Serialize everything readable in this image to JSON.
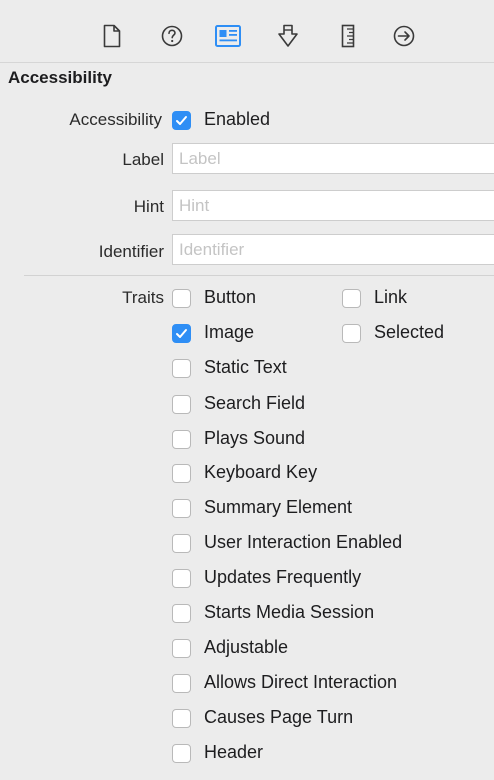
{
  "toolbar": {
    "icons": [
      "file-icon",
      "help-icon",
      "identity-inspector-icon",
      "attributes-icon",
      "size-ruler-icon",
      "connections-arrow-icon"
    ],
    "accent": "#2e8ef5"
  },
  "section": {
    "title": "Accessibility"
  },
  "accessibility": {
    "label": "Accessibility",
    "enabled_label": "Enabled",
    "enabled": true
  },
  "label_field": {
    "label": "Label",
    "placeholder": "Label",
    "value": ""
  },
  "hint_field": {
    "label": "Hint",
    "placeholder": "Hint",
    "value": ""
  },
  "identifier_field": {
    "label": "Identifier",
    "placeholder": "Identifier",
    "value": ""
  },
  "traits": {
    "label": "Traits",
    "items": [
      {
        "label": "Button",
        "checked": false
      },
      {
        "label": "Link",
        "checked": false
      },
      {
        "label": "Image",
        "checked": true
      },
      {
        "label": "Selected",
        "checked": false
      },
      {
        "label": "Static Text",
        "checked": false
      },
      {
        "label": "Search Field",
        "checked": false
      },
      {
        "label": "Plays Sound",
        "checked": false
      },
      {
        "label": "Keyboard Key",
        "checked": false
      },
      {
        "label": "Summary Element",
        "checked": false
      },
      {
        "label": "User Interaction Enabled",
        "checked": false
      },
      {
        "label": "Updates Frequently",
        "checked": false
      },
      {
        "label": "Starts Media Session",
        "checked": false
      },
      {
        "label": "Adjustable",
        "checked": false
      },
      {
        "label": "Allows Direct Interaction",
        "checked": false
      },
      {
        "label": "Causes Page Turn",
        "checked": false
      },
      {
        "label": "Header",
        "checked": false
      }
    ]
  }
}
